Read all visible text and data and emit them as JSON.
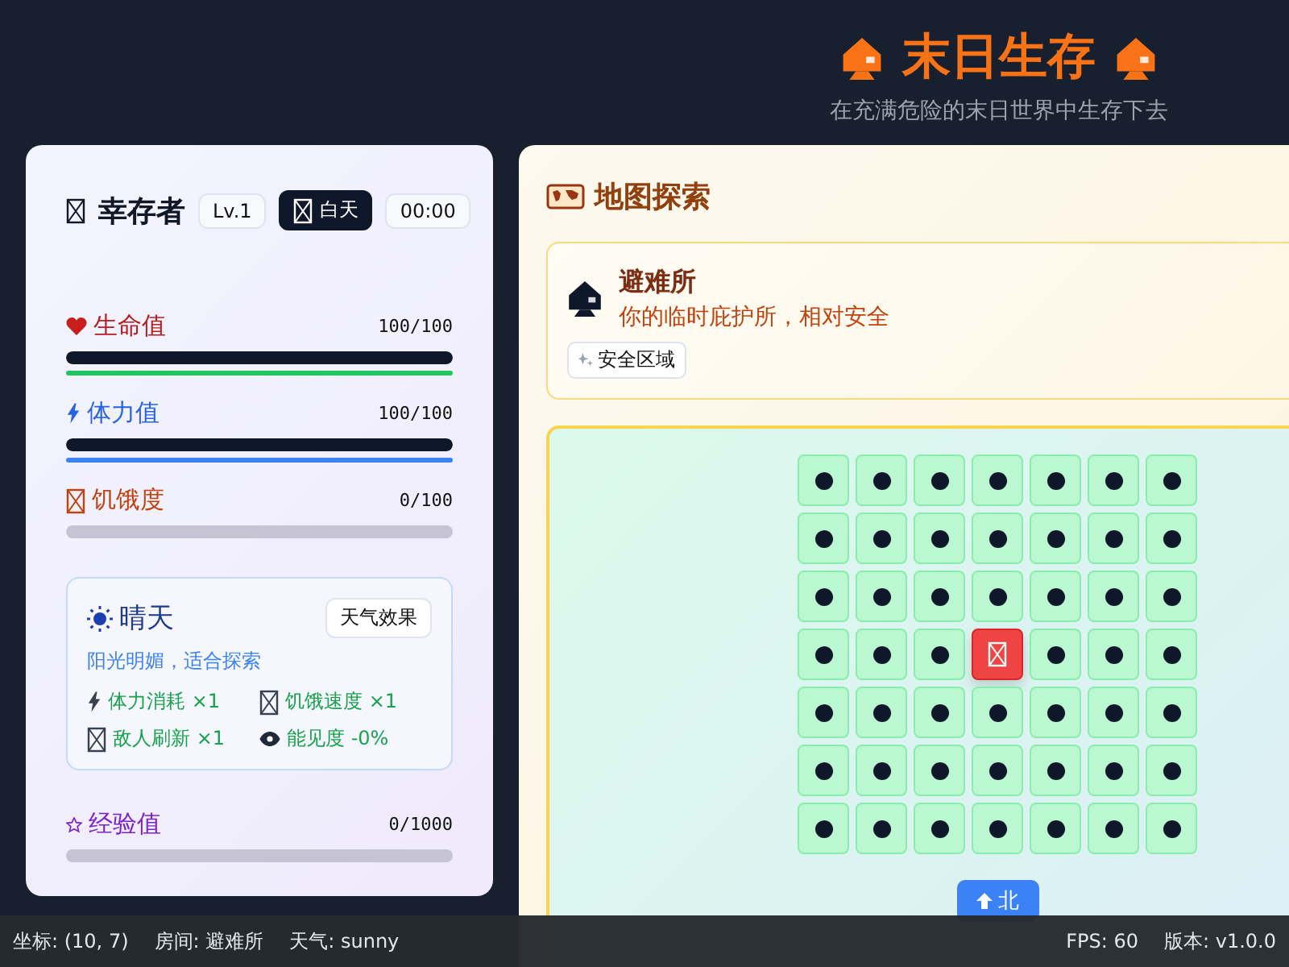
{
  "header": {
    "title": "末日生存",
    "subtitle": "在充满危险的末日世界中生存下去"
  },
  "player": {
    "name": "幸存者",
    "level": "Lv.1",
    "phase": "白天",
    "time": "00:00"
  },
  "stats": [
    {
      "kind": "health",
      "name": "生命值",
      "reading": "100/100",
      "level": 1,
      "color": "#22c55e"
    },
    {
      "kind": "stamina",
      "name": "体力值",
      "reading": "100/100",
      "level": 1,
      "color": "#3b82f6"
    },
    {
      "kind": "hunger",
      "name": "饥饿度",
      "reading": "0/100",
      "level": 0
    }
  ],
  "weather": {
    "name": "晴天",
    "button": "天气效果",
    "description": "阳光明媚，适合探索",
    "effects": [
      {
        "text": "体力消耗 ×1"
      },
      {
        "text": "饥饿速度 ×1"
      },
      {
        "text": "敌人刷新 ×1"
      },
      {
        "text": "能见度 -0%"
      }
    ]
  },
  "experience": {
    "name": "经验值",
    "reading": "0/1000",
    "level": 0
  },
  "map": {
    "title": "地图探索",
    "room": {
      "name": "避难所",
      "description": "你的临时庇护所，相对安全",
      "tag": "安全区域"
    },
    "cells": [
      {
        "kind": "dot"
      },
      {
        "kind": "dot"
      },
      {
        "kind": "dot"
      },
      {
        "kind": "dot"
      },
      {
        "kind": "dot"
      },
      {
        "kind": "dot"
      },
      {
        "kind": "dot"
      },
      {
        "kind": "dot"
      },
      {
        "kind": "dot"
      },
      {
        "kind": "dot"
      },
      {
        "kind": "dot"
      },
      {
        "kind": "dot"
      },
      {
        "kind": "dot"
      },
      {
        "kind": "dot"
      },
      {
        "kind": "dot"
      },
      {
        "kind": "dot"
      },
      {
        "kind": "dot"
      },
      {
        "kind": "dot"
      },
      {
        "kind": "dot"
      },
      {
        "kind": "dot"
      },
      {
        "kind": "dot"
      },
      {
        "kind": "dot"
      },
      {
        "kind": "dot"
      },
      {
        "kind": "dot"
      },
      {
        "kind": "player"
      },
      {
        "kind": "dot"
      },
      {
        "kind": "dot"
      },
      {
        "kind": "dot"
      },
      {
        "kind": "dot"
      },
      {
        "kind": "dot"
      },
      {
        "kind": "dot"
      },
      {
        "kind": "dot"
      },
      {
        "kind": "dot"
      },
      {
        "kind": "dot"
      },
      {
        "kind": "dot"
      },
      {
        "kind": "dot"
      },
      {
        "kind": "dot"
      },
      {
        "kind": "dot"
      },
      {
        "kind": "dot"
      },
      {
        "kind": "dot"
      },
      {
        "kind": "dot"
      },
      {
        "kind": "dot"
      },
      {
        "kind": "dot"
      },
      {
        "kind": "dot"
      },
      {
        "kind": "dot"
      },
      {
        "kind": "dot"
      },
      {
        "kind": "dot"
      },
      {
        "kind": "dot"
      },
      {
        "kind": "dot"
      }
    ],
    "move_button": "北"
  },
  "status_bar": {
    "left": [
      "坐标: (10, 7)",
      "房间: 避难所",
      "天气: sunny"
    ],
    "right": [
      "FPS: 60",
      "版本: v1.0.0"
    ]
  }
}
